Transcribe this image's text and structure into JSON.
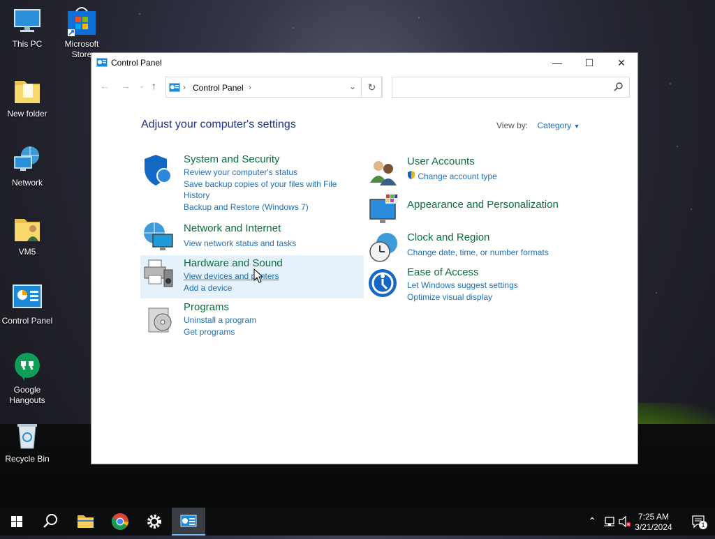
{
  "desktop": {
    "icons": [
      {
        "label": "This PC"
      },
      {
        "label": "Microsoft Store"
      },
      {
        "label": "New folder"
      },
      {
        "label": "Network"
      },
      {
        "label": "VM5"
      },
      {
        "label": "Control Panel"
      },
      {
        "label": "Google Hangouts"
      },
      {
        "label": "Recycle Bin"
      }
    ]
  },
  "window": {
    "title": "Control Panel",
    "address": {
      "crumb": "Control Panel",
      "separator": "›"
    },
    "search": {
      "placeholder": ""
    },
    "heading": "Adjust your computer's settings",
    "view_by": {
      "label": "View by:",
      "value": "Category"
    },
    "categories": [
      {
        "title": "System and Security",
        "links": [
          "Review your computer's status",
          "Save backup copies of your files with File History",
          "Backup and Restore (Windows 7)"
        ]
      },
      {
        "title": "Network and Internet",
        "links": [
          "View network status and tasks"
        ]
      },
      {
        "title": "Hardware and Sound",
        "links": [
          "View devices and printers",
          "Add a device"
        ]
      },
      {
        "title": "Programs",
        "links": [
          "Uninstall a program",
          "Get programs"
        ]
      },
      {
        "title": "User Accounts",
        "links": [
          "Change account type"
        ]
      },
      {
        "title": "Appearance and Personalization",
        "links": []
      },
      {
        "title": "Clock and Region",
        "links": [
          "Change date, time, or number formats"
        ]
      },
      {
        "title": "Ease of Access",
        "links": [
          "Let Windows suggest settings",
          "Optimize visual display"
        ]
      }
    ]
  },
  "taskbar": {
    "clock": {
      "time": "7:25 AM",
      "date": "3/21/2024"
    },
    "notification_count": "1"
  },
  "colors": {
    "link": "#1e6fb8",
    "category_title": "#0a6e3c",
    "heading": "#1e3287",
    "hover": "#e5f1fb"
  }
}
